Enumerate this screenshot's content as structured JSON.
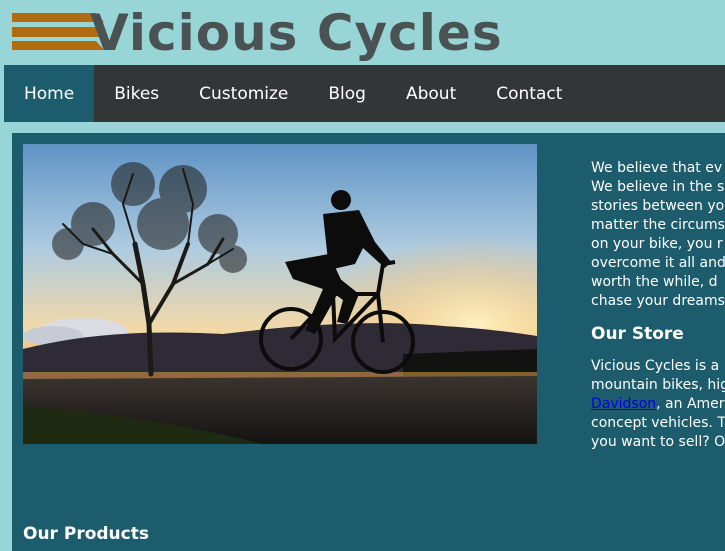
{
  "brand": {
    "name": "Vicious Cycles",
    "stripe_color": "#b36b12",
    "text_color": "#4b5254"
  },
  "nav": {
    "items": [
      {
        "label": "Home",
        "active": true
      },
      {
        "label": "Bikes",
        "active": false
      },
      {
        "label": "Customize",
        "active": false
      },
      {
        "label": "Blog",
        "active": false
      },
      {
        "label": "About",
        "active": false
      },
      {
        "label": "Contact",
        "active": false
      }
    ]
  },
  "intro": {
    "lines": [
      "We believe that ev",
      "We believe in the s",
      "stories between yo",
      "matter the circums",
      "on your bike, you r",
      "overcome it all and",
      "worth the while, d",
      "chase your dreams"
    ]
  },
  "store": {
    "title": "Our Store",
    "line1": "Vicious Cycles is a",
    "line2": "mountain bikes, hig",
    "line3_link": "Davidson",
    "line3_rest": ", an Ameri",
    "line4": "concept vehicles. T",
    "line5": "you want to sell? O"
  },
  "products": {
    "title": "Our Products"
  },
  "colors": {
    "page_bg": "#98d5d6",
    "nav_bg": "#333637",
    "accent": "#1c5c6c"
  }
}
